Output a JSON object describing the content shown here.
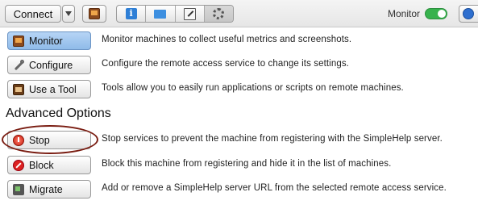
{
  "toolbar": {
    "connect_label": "Connect",
    "monitor_label": "Monitor",
    "monitor_toggle_on": true,
    "icons": [
      "monitor-app-icon",
      "info-icon",
      "folder-icon",
      "edit-icon",
      "gear-icon",
      "globe-icon"
    ]
  },
  "actions": [
    {
      "label": "Monitor",
      "icon": "monitor-icon",
      "description": "Monitor machines to collect useful metrics and screenshots."
    },
    {
      "label": "Configure",
      "icon": "wrench-icon",
      "description": "Configure the remote access service to change its settings."
    },
    {
      "label": "Use a Tool",
      "icon": "tool-icon",
      "description": "Tools allow you to easily run applications or scripts on remote machines."
    }
  ],
  "advanced": {
    "title": "Advanced Options",
    "actions": [
      {
        "label": "Stop",
        "icon": "stop-icon",
        "description": "Stop services to prevent the machine from registering with the SimpleHelp server."
      },
      {
        "label": "Block",
        "icon": "block-icon",
        "description": "Block this machine from registering and hide it in the list of machines."
      },
      {
        "label": "Migrate",
        "icon": "migrate-icon",
        "description": "Add or remove a SimpleHelp server URL from the selected remote access service."
      }
    ]
  },
  "colors": {
    "active_button": "#9fc5ef",
    "toggle_on": "#37b24d",
    "highlight_ring": "#7a1d12"
  }
}
